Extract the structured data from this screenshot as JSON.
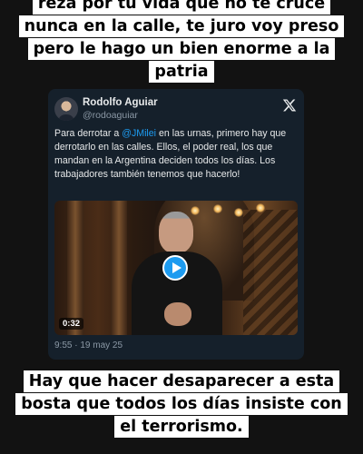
{
  "story": {
    "top_caption": [
      "reza por tu vida que no te cruce",
      "nunca en la calle, te juro voy preso",
      "pero le hago un bien enorme a la",
      "patria"
    ],
    "bottom_caption": [
      "Hay que hacer desaparecer a esta",
      "bosta que todos los días insiste con",
      "el terrorismo."
    ]
  },
  "tweet": {
    "author_name": "Rodolfo Aguiar",
    "author_handle": "@rodoaguiar",
    "logo_icon": "x-logo-icon",
    "text_before": "Para derrotar a ",
    "mention": "@JMilei",
    "text_after": " en las urnas, primero hay que derrotarlo en las calles. Ellos, el poder real, los que mandan en la Argentina deciden todos los días. Los trabajadores también tenemos que hacerlo!",
    "video": {
      "duration": "0:32",
      "play_icon": "play-icon"
    },
    "timestamp": "9:55 · 19 may 25"
  },
  "colors": {
    "background": "#121212",
    "card": "#15202b",
    "accent": "#1d9bf0",
    "caption_bg": "#ffffff"
  }
}
